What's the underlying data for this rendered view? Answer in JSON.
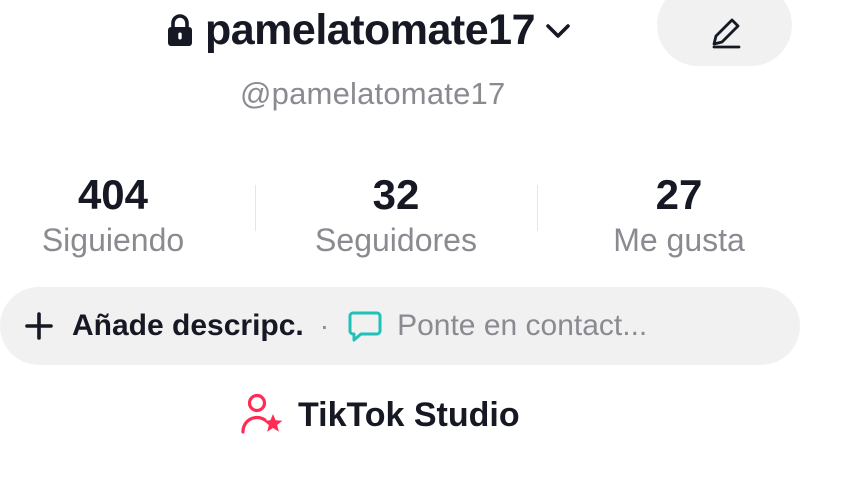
{
  "header": {
    "username": "pamelatomate17",
    "handle": "@pamelatomate17",
    "icons": {
      "lock": "lock-icon",
      "switch_account": "chevron-down-icon",
      "edit": "pencil-icon"
    }
  },
  "stats": [
    {
      "value": "404",
      "label": "Siguiendo"
    },
    {
      "value": "32",
      "label": "Seguidores"
    },
    {
      "value": "27",
      "label": "Me gusta"
    }
  ],
  "bio": {
    "add_label": "Añade descripc.",
    "separator": "·",
    "contact_label": "Ponte en contact...",
    "icons": {
      "add": "plus-icon",
      "contact": "chat-bubble-icon"
    },
    "contact_icon_color": "#20c1b8"
  },
  "studio": {
    "label": "TikTok Studio",
    "icon": "person-star-icon",
    "icon_color": "#fe2c55"
  },
  "colors": {
    "text_primary": "#161823",
    "text_secondary": "#8a8b91",
    "pill_background": "#f1f1f2"
  }
}
